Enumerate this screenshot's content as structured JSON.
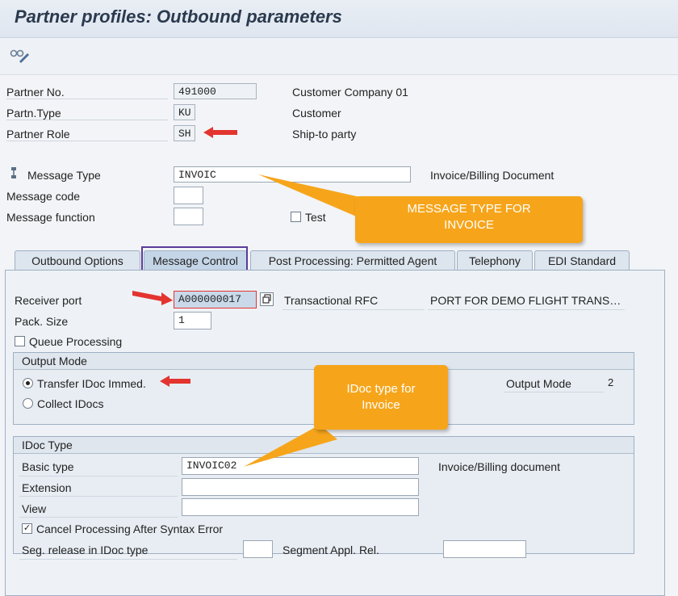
{
  "title": "Partner profiles: Outbound parameters",
  "toolbar": {
    "glasses_icon": "display-change-icon"
  },
  "partner": {
    "no_label": "Partner No.",
    "no_value": "491000",
    "no_desc": "Customer Company 01",
    "type_label": "Partn.Type",
    "type_value": "KU",
    "type_desc": "Customer",
    "role_label": "Partner Role",
    "role_value": "SH",
    "role_desc": "Ship-to party"
  },
  "message": {
    "type_label": "Message Type",
    "type_value": "INVOIC",
    "type_desc": "Invoice/Billing Document",
    "code_label": "Message code",
    "code_value": "",
    "function_label": "Message function",
    "function_value": "",
    "test_label": "Test"
  },
  "callouts": {
    "message_type": "MESSAGE TYPE FOR INVOICE",
    "idoc_type": "IDoc type for Invoice"
  },
  "tabs": [
    {
      "label": "Outbound Options"
    },
    {
      "label": "Message Control"
    },
    {
      "label": "Post Processing: Permitted Agent"
    },
    {
      "label": "Telephony"
    },
    {
      "label": "EDI Standard"
    }
  ],
  "outbound": {
    "receiver_label": "Receiver port",
    "receiver_value": "A000000017",
    "receiver_desc": "Transactional RFC",
    "receiver_desc2": "PORT FOR DEMO FLIGHT TRANS…",
    "pack_label": "Pack. Size",
    "pack_value": "1",
    "queue_label": "Queue Processing",
    "output_mode_group": "Output Mode",
    "transfer_label": "Transfer IDoc Immed.",
    "collect_label": "Collect IDocs",
    "output_mode_label": "Output Mode",
    "output_mode_value": "2",
    "idoc_group": "IDoc Type",
    "basic_label": "Basic type",
    "basic_value": "INVOIC02",
    "basic_desc": "Invoice/Billing document",
    "extension_label": "Extension",
    "extension_value": "",
    "view_label": "View",
    "view_value": "",
    "cancel_label": "Cancel Processing After Syntax Error",
    "seg_label": "Seg. release in IDoc type",
    "seg_value": "",
    "segappl_label": "Segment Appl. Rel.",
    "segappl_value": ""
  },
  "colors": {
    "callout": "#f6a51b",
    "arrow": "#e3342f",
    "highlight": "#5b3b9a"
  }
}
